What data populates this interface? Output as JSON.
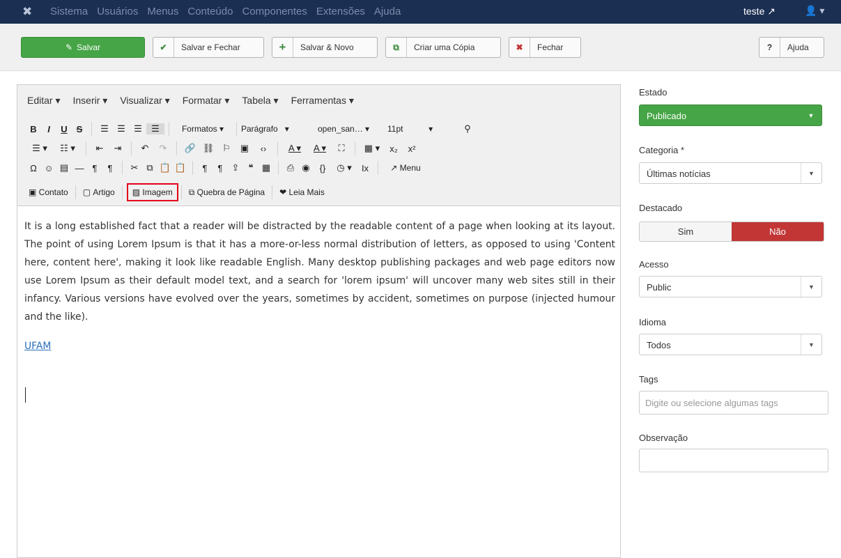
{
  "topbar": {
    "menu": [
      "Sistema",
      "Usuários",
      "Menus",
      "Conteúdo",
      "Componentes",
      "Extensões",
      "Ajuda"
    ],
    "user": "teste",
    "logo_icon": "joomla-icon",
    "user_icon": "user-icon"
  },
  "toolbar": {
    "save": "Salvar",
    "save_close": "Salvar e Fechar",
    "save_new": "Salvar & Novo",
    "copy": "Criar uma Cópia",
    "close": "Fechar",
    "help": "Ajuda"
  },
  "editor": {
    "menus": [
      "Editar",
      "Inserir",
      "Visualizar",
      "Formatar",
      "Tabela",
      "Ferramentas"
    ],
    "formats": "Formatos",
    "paragraph": "Parágrafo",
    "font": "open_san…",
    "size": "11pt",
    "menu_btn": "Menu",
    "buttons": [
      "Contato",
      "Artigo",
      "Imagem",
      "Quebra de Página",
      "Leia Mais"
    ],
    "paragraph_text": "It is a long established fact that a reader will be distracted by the readable content of a page when looking at its layout. The point of using Lorem Ipsum is that it has a more-or-less normal distribution of letters, as opposed to using 'Content here, content here', making it look like readable English. Many desktop publishing packages and web page editors now use Lorem Ipsum as their default model text, and a search for 'lorem ipsum' will uncover many web sites still in their infancy. Various versions have evolved over the years, sometimes by accident, sometimes on purpose (injected humour and the like).",
    "link_text": "UFAM"
  },
  "sidebar": {
    "estado_label": "Estado",
    "estado_value": "Publicado",
    "categoria_label": "Categoria *",
    "categoria_value": "Últimas notícias",
    "destacado_label": "Destacado",
    "sim": "Sim",
    "nao": "Não",
    "acesso_label": "Acesso",
    "acesso_value": "Public",
    "idioma_label": "Idioma",
    "idioma_value": "Todos",
    "tags_label": "Tags",
    "tags_placeholder": "Digite ou selecione algumas tags",
    "obs_label": "Observação"
  },
  "colors": {
    "topbar": "#1b2f52",
    "green": "#46a546",
    "red": "#c23636",
    "highlight": "#e3001b"
  }
}
